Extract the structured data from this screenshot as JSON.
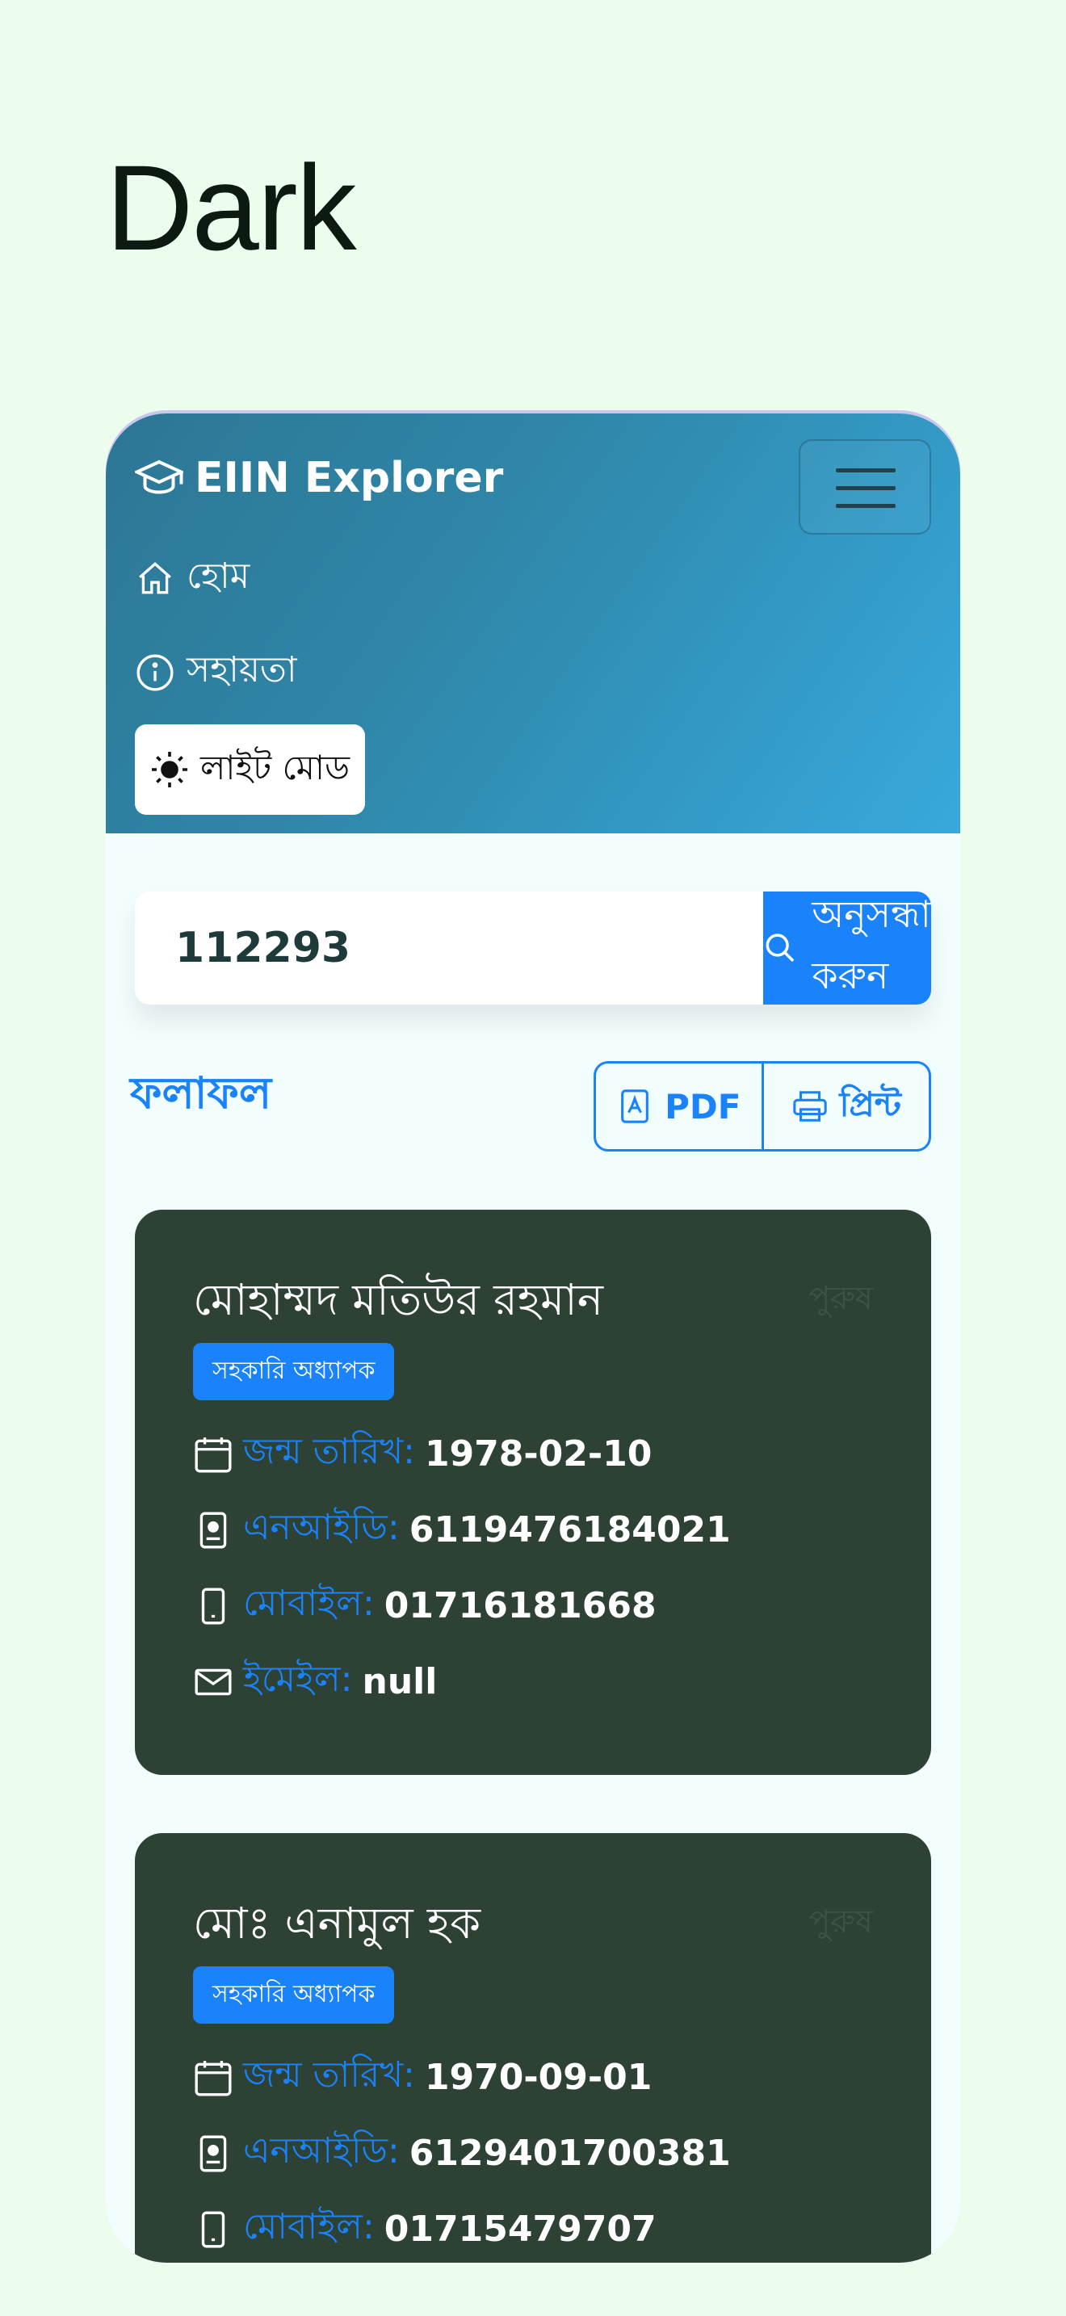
{
  "heading": "Dark",
  "app": {
    "brand": "EIIN Explorer",
    "nav": {
      "home": "হোম",
      "help": "সহায়তা"
    },
    "mode_toggle": "লাইট মোড"
  },
  "search": {
    "value": "112293",
    "button_label": "অনুসন্ধান করুন"
  },
  "results": {
    "title": "ফলাফল",
    "export": {
      "pdf": "PDF",
      "print": "প্রিন্ট"
    }
  },
  "cards": [
    {
      "name": "মোহাম্মদ মতিউর রহমান",
      "ghost": "পুরুষ",
      "designation": "সহকারি অধ্যাপক",
      "dob_label": "জন্ম তারিখ:",
      "dob": "1978-02-10",
      "nid_label": "এনআইডি:",
      "nid": "6119476184021",
      "mobile_label": "মোবাইল:",
      "mobile": "01716181668",
      "email_label": "ইমেইল:",
      "email": "null"
    },
    {
      "name": "মোঃ এনামুল হক",
      "ghost": "পুরুষ",
      "designation": "সহকারি অধ্যাপক",
      "dob_label": "জন্ম তারিখ:",
      "dob": "1970-09-01",
      "nid_label": "এনআইডি:",
      "nid": "6129401700381",
      "mobile_label": "মোবাইল:",
      "mobile": "01715479707"
    }
  ],
  "colors": {
    "page_bg": "#ecfdee",
    "accent": "#1a82fb",
    "card_bg": "#2d4235"
  }
}
